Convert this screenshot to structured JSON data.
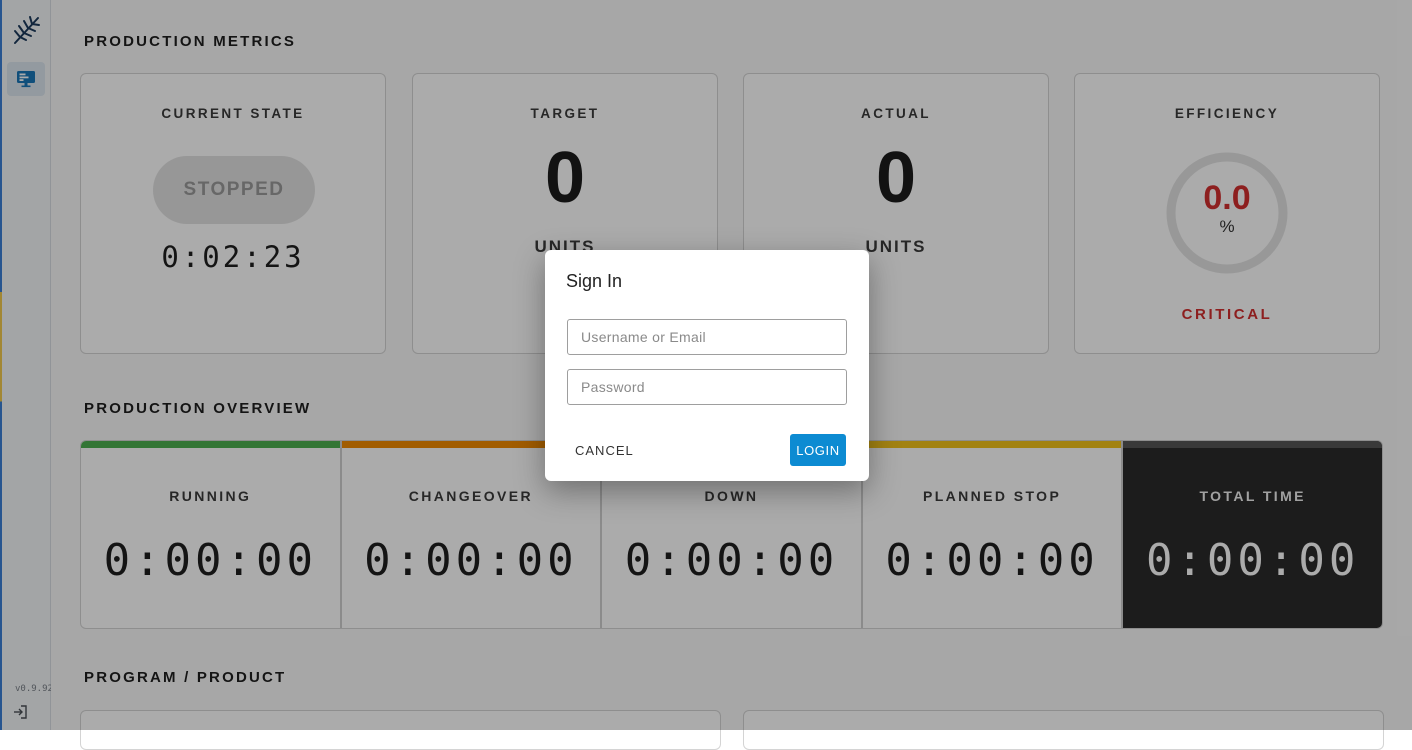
{
  "sidebar": {
    "logo_icon": "fern-leaf-icon",
    "nav_items": [
      {
        "icon": "monitor-dashboard-icon",
        "active": true
      }
    ],
    "version": "v0.9.92",
    "logout_icon": "logout-icon"
  },
  "metrics": {
    "title": "PRODUCTION METRICS",
    "current_state": {
      "label": "CURRENT STATE",
      "state": "STOPPED",
      "timer": "0:02:23"
    },
    "target": {
      "label": "TARGET",
      "value": "0",
      "unit": "UNITS"
    },
    "actual": {
      "label": "ACTUAL",
      "value": "0",
      "unit": "UNITS"
    },
    "efficiency": {
      "label": "EFFICIENCY",
      "value": "0.0",
      "unit": "%",
      "status": "CRITICAL",
      "fraction": 0.0
    }
  },
  "overview": {
    "title": "PRODUCTION OVERVIEW",
    "cells": [
      {
        "label": "RUNNING",
        "time": "0:00:00",
        "color": "#4caf50"
      },
      {
        "label": "CHANGEOVER",
        "time": "0:00:00",
        "color": "#f08a00"
      },
      {
        "label": "DOWN",
        "time": "0:00:00",
        "color": "#f08a00"
      },
      {
        "label": "PLANNED STOP",
        "time": "0:00:00",
        "color": "#f2c21b"
      },
      {
        "label": "TOTAL TIME",
        "time": "0:00:00",
        "color": "#555555"
      }
    ]
  },
  "program": {
    "title": "PROGRAM / PRODUCT"
  },
  "dialog": {
    "title": "Sign In",
    "username_placeholder": "Username or Email",
    "password_placeholder": "Password",
    "cancel_label": "CANCEL",
    "login_label": "LOGIN"
  },
  "colors": {
    "accent": "#0d8bd2",
    "critical": "#d32f2f"
  }
}
